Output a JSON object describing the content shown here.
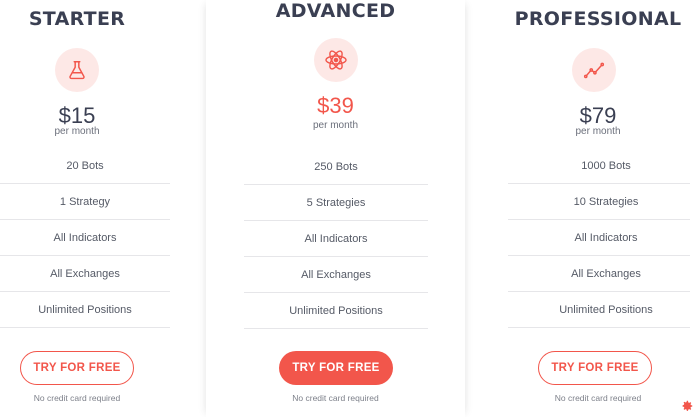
{
  "colors": {
    "accent": "#f2564b",
    "icon_bg": "#fde8e6",
    "title": "#3a3f52"
  },
  "plans": [
    {
      "title": "STARTER",
      "icon": "flask-icon",
      "price": "$15",
      "period": "per month",
      "features": [
        "20 Bots",
        "1 Strategy",
        "All Indicators",
        "All Exchanges",
        "Unlimited Positions"
      ],
      "cta": "TRY FOR FREE",
      "note": "No credit card required"
    },
    {
      "title": "ADVANCED",
      "icon": "atom-icon",
      "price": "$39",
      "period": "per month",
      "features": [
        "250 Bots",
        "5 Strategies",
        "All Indicators",
        "All Exchanges",
        "Unlimited Positions"
      ],
      "cta": "TRY FOR FREE",
      "note": "No credit card required"
    },
    {
      "title": "PROFESSIONAL",
      "icon": "line-chart-icon",
      "price": "$79",
      "period": "per month",
      "features": [
        "1000 Bots",
        "10 Strategies",
        "All Indicators",
        "All Exchanges",
        "Unlimited Positions"
      ],
      "cta": "TRY FOR FREE",
      "note": "No credit card required"
    }
  ],
  "footer_icon": "settings-gear-icon"
}
